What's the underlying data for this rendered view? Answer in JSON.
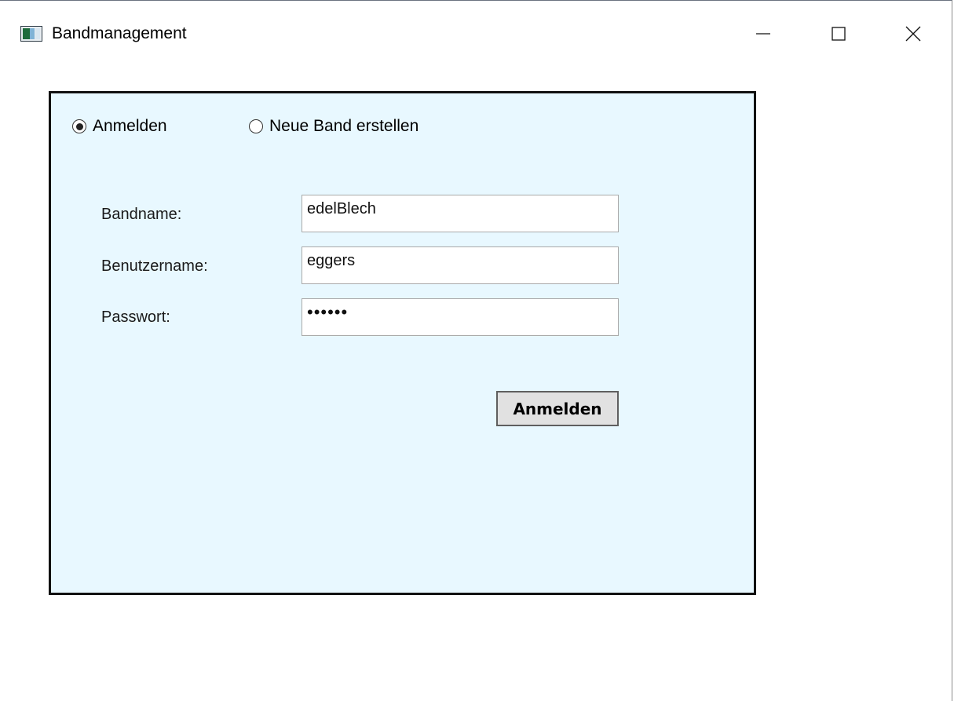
{
  "window": {
    "title": "Bandmanagement",
    "controls": {
      "minimize": "minimize-icon",
      "maximize": "maximize-icon",
      "close": "close-icon"
    }
  },
  "mode": {
    "options": [
      {
        "label": "Anmelden",
        "selected": true
      },
      {
        "label": "Neue Band erstellen",
        "selected": false
      }
    ]
  },
  "form": {
    "bandname": {
      "label": "Bandname:",
      "value": "edelBlech"
    },
    "username": {
      "label": "Benutzername:",
      "value": "eggers"
    },
    "password": {
      "label": "Passwort:",
      "masked_value": "••••••"
    },
    "submit_label": "Anmelden"
  },
  "colors": {
    "panel_background": "#e8f8ff",
    "panel_border": "#111111",
    "button_background": "#e1e1e1"
  }
}
